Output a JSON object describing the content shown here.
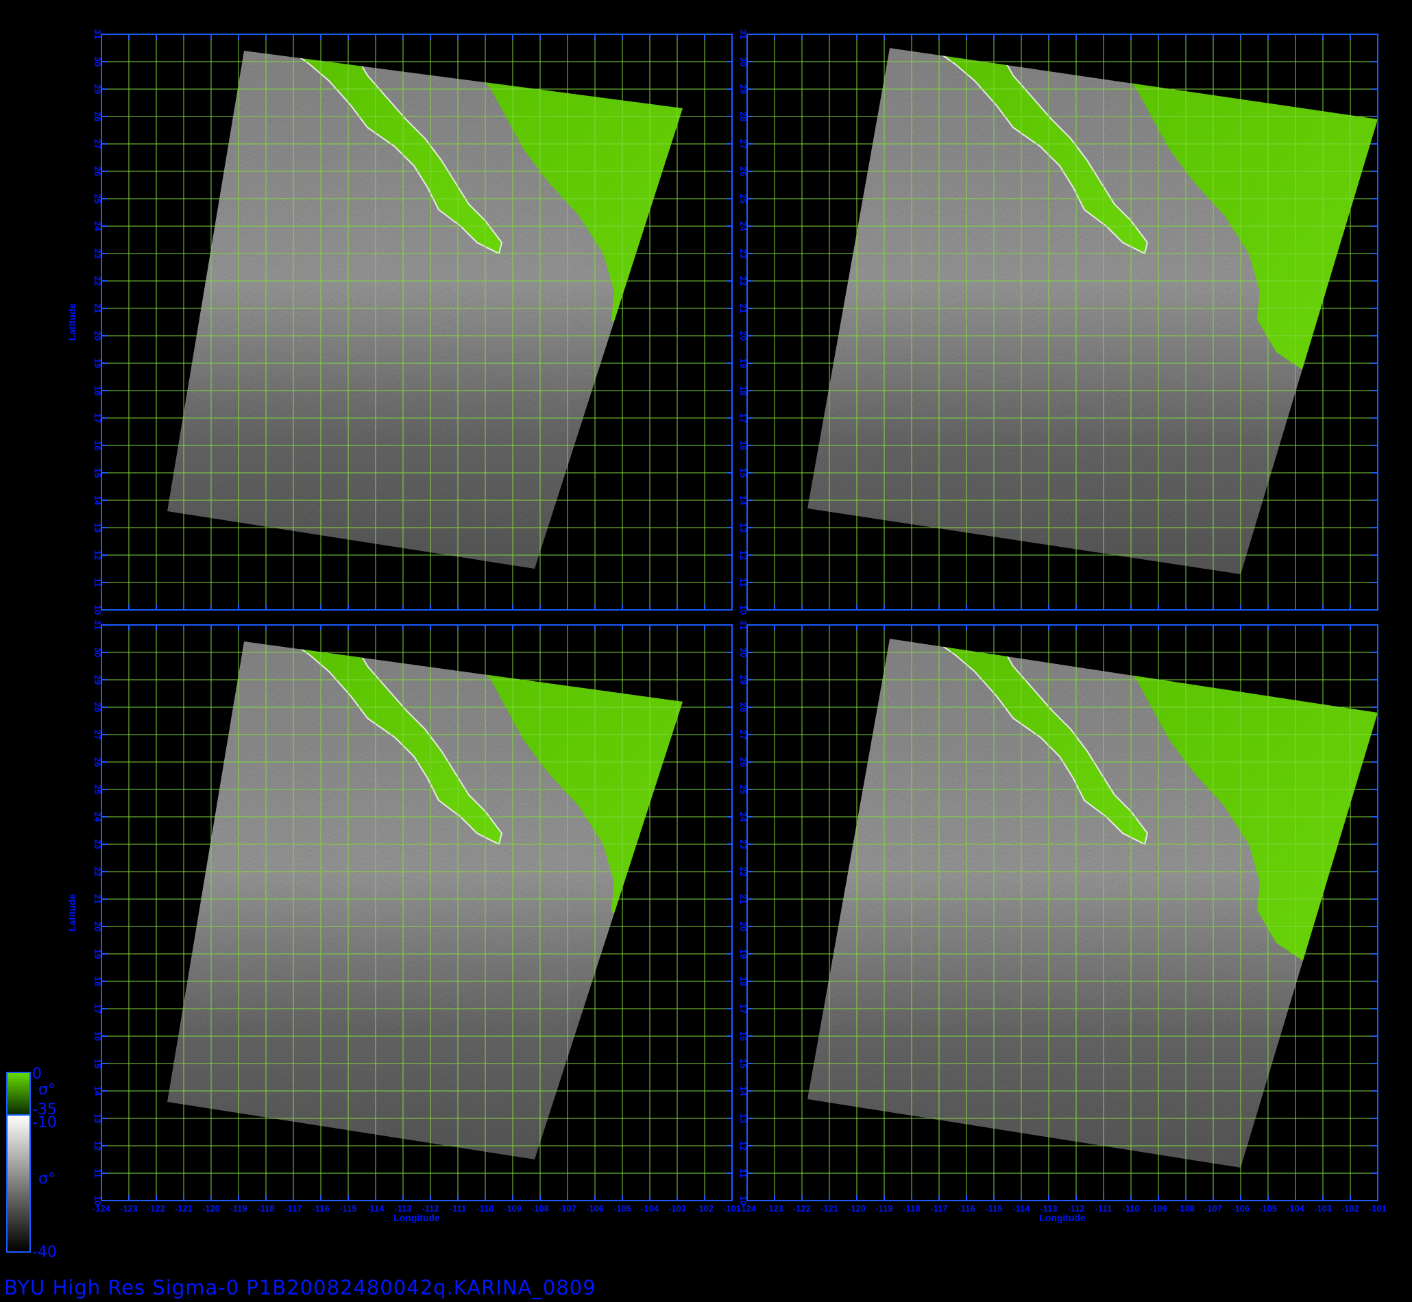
{
  "caption": "BYU  High  Res  Sigma-0  P1B20082480042q.KARINA_0809",
  "colors": {
    "frame": "#1a5cff",
    "grid": "#7fd93a",
    "axis_text": "#0018ff",
    "land": "#5cc400",
    "background": "#000000"
  },
  "axes": {
    "lon_label": "Longitude",
    "lat_label": "Latitude",
    "lon_range": [
      -124,
      -101
    ],
    "lat_range": [
      10,
      31
    ],
    "lon_ticks": [
      "-124",
      "-123",
      "-122",
      "-121",
      "-120",
      "-119",
      "-118",
      "-117",
      "-116",
      "-115",
      "-114",
      "-113",
      "-112",
      "-111",
      "-110",
      "-109",
      "-108",
      "-107",
      "-106",
      "-105",
      "-104",
      "-103",
      "-102",
      "-101"
    ],
    "lat_ticks": [
      "10",
      "11",
      "12",
      "13",
      "14",
      "15",
      "16",
      "17",
      "18",
      "19",
      "20",
      "21",
      "22",
      "23",
      "24",
      "25",
      "26",
      "27",
      "28",
      "29",
      "30",
      "31"
    ]
  },
  "panels": [
    {
      "id": "top-left",
      "swath_corners": [
        [
          -118.8,
          30.4
        ],
        [
          -102.8,
          28.3
        ],
        [
          -108.2,
          11.5
        ],
        [
          -121.6,
          13.6
        ]
      ]
    },
    {
      "id": "top-right",
      "swath_corners": [
        [
          -118.8,
          30.5
        ],
        [
          -101.0,
          27.9
        ],
        [
          -106.0,
          11.3
        ],
        [
          -121.8,
          13.7
        ]
      ]
    },
    {
      "id": "bottom-left",
      "swath_corners": [
        [
          -118.8,
          30.4
        ],
        [
          -102.8,
          28.2
        ],
        [
          -108.2,
          11.5
        ],
        [
          -121.6,
          13.6
        ]
      ]
    },
    {
      "id": "bottom-right",
      "swath_corners": [
        [
          -118.8,
          30.5
        ],
        [
          -101.0,
          27.8
        ],
        [
          -106.0,
          11.2
        ],
        [
          -121.8,
          13.7
        ]
      ]
    }
  ],
  "colorbar": {
    "land": {
      "top": "0",
      "bottom": "-35",
      "symbol": "σ°"
    },
    "ocean": {
      "top": "-10",
      "bottom": "-40",
      "symbol": "σ°"
    }
  }
}
